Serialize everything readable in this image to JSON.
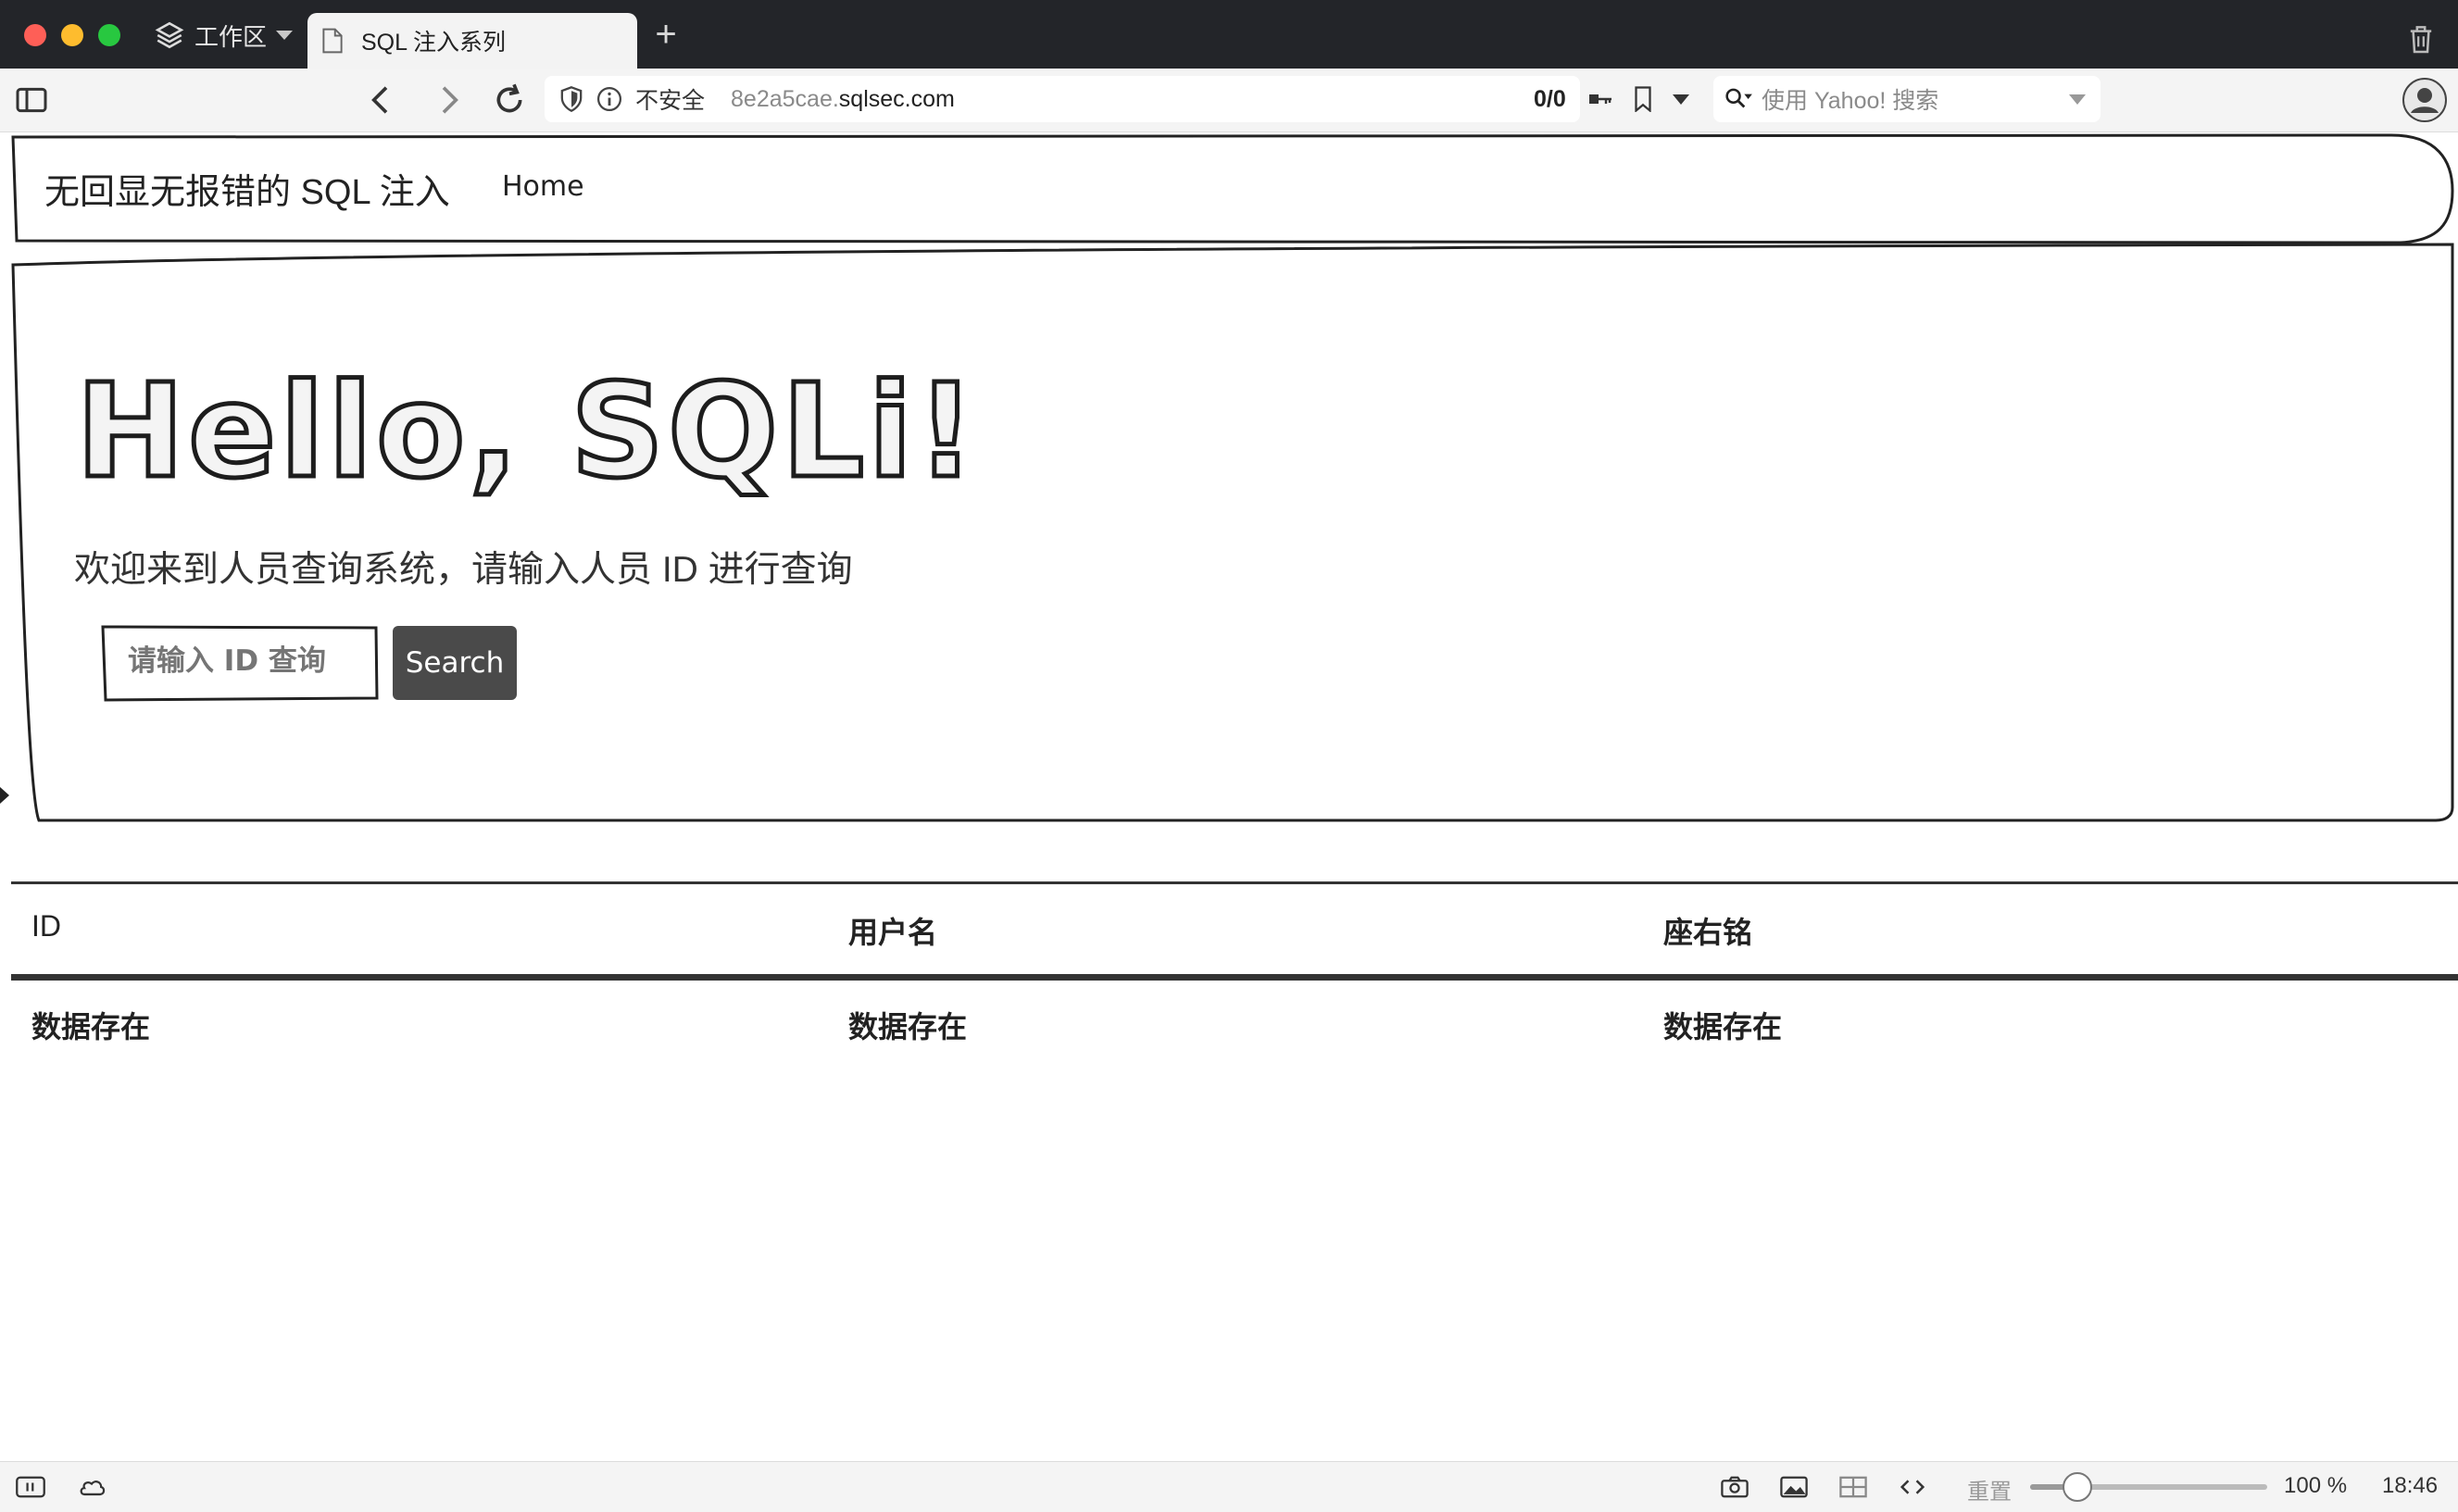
{
  "browser": {
    "workspace_label": "工作区",
    "tab_title": "SQL 注入系列",
    "security_label": "不安全",
    "url_sub": "8e2a5cae.",
    "url_domain": "sqlsec.com",
    "page_counter": "0/0",
    "search_placeholder": "使用 Yahoo! 搜索"
  },
  "page": {
    "brand": "无回显无报错的 SQL 注入",
    "nav_home": "Home",
    "heading": "Hello, SQLi!",
    "lead": "欢迎来到人员查询系统，请输入人员 ID 进行查询",
    "input_placeholder": "请输入 ID 查询",
    "search_button": "Search"
  },
  "table": {
    "headers": [
      "ID",
      "用户名",
      "座右铭"
    ],
    "rows": [
      [
        "数据存在",
        "数据存在",
        "数据存在"
      ]
    ]
  },
  "statusbar": {
    "reset_label": "重置",
    "zoom": "100 %",
    "zoom_level": 0.2,
    "clock": "18:46"
  },
  "icons": {
    "tabbar": [
      "workspace-layers-icon",
      "document-icon",
      "new-tab-icon",
      "trash-icon"
    ],
    "toolbar": [
      "sidebar-toggle-icon",
      "back-icon",
      "forward-icon",
      "reload-icon",
      "shield-icon",
      "info-icon",
      "key-icon",
      "bookmark-icon",
      "search-icon",
      "profile-icon"
    ],
    "statusbar": [
      "panel-icon",
      "cloud-icon",
      "camera-icon",
      "image-icon",
      "layout-icon",
      "code-icon"
    ]
  }
}
